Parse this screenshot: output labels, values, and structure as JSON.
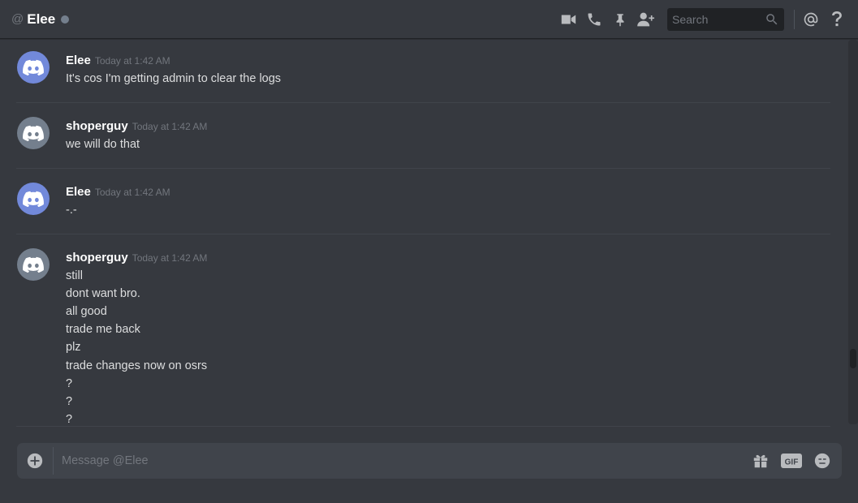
{
  "header": {
    "at_symbol": "@",
    "channel_name": "Elee",
    "status_color": "#747f8d",
    "icons": [
      "video-call-icon",
      "voice-call-icon",
      "pin-icon",
      "add-friend-icon",
      "mention-icon",
      "help-icon"
    ]
  },
  "search": {
    "placeholder": "Search"
  },
  "messages": [
    {
      "author": "Elee",
      "timestamp": "Today at 1:42 AM",
      "avatar_color": "#7289da",
      "lines": [
        "It's cos I'm getting admin to clear the logs"
      ]
    },
    {
      "author": "shoperguy",
      "timestamp": "Today at 1:42 AM",
      "avatar_color": "#747f8d",
      "lines": [
        "we will do that"
      ]
    },
    {
      "author": "Elee",
      "timestamp": "Today at 1:42 AM",
      "avatar_color": "#7289da",
      "lines": [
        "-.-"
      ]
    },
    {
      "author": "shoperguy",
      "timestamp": "Today at 1:42 AM",
      "avatar_color": "#747f8d",
      "lines": [
        "still",
        "dont want bro.",
        "all good",
        "trade me back",
        "plz",
        "trade changes now on osrs",
        "?",
        "?",
        "?"
      ]
    }
  ],
  "composer": {
    "placeholder": "Message @Elee",
    "gif_label": "GIF",
    "icons": [
      "add-attachment-icon",
      "gift-icon",
      "gif-icon",
      "emoji-icon"
    ]
  }
}
